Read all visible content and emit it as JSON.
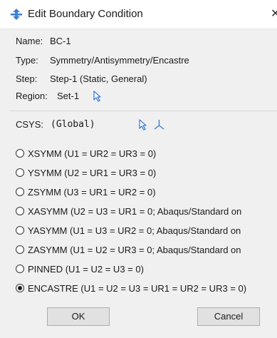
{
  "window": {
    "title": "Edit Boundary Condition",
    "close_glyph": "✕",
    "title_icon": "boundary-condition-icon"
  },
  "info": {
    "name_label": "Name:",
    "name_value": "BC-1",
    "type_label": "Type:",
    "type_value": "Symmetry/Antisymmetry/Encastre",
    "step_label": "Step:",
    "step_value": "Step-1 (Static, General)",
    "region_label": "Region:",
    "region_value": "Set-1"
  },
  "csys": {
    "label": "CSYS:",
    "value": "(Global)"
  },
  "options": [
    {
      "label": "XSYMM (U1 = UR2 = UR3 = 0)",
      "selected": false
    },
    {
      "label": "YSYMM (U2 = UR1 = UR3 = 0)",
      "selected": false
    },
    {
      "label": "ZSYMM (U3 = UR1 = UR2 = 0)",
      "selected": false
    },
    {
      "label": "XASYMM (U2 = U3 = UR1 = 0; Abaqus/Standard on",
      "selected": false
    },
    {
      "label": "YASYMM (U1 = U3 = UR2 = 0; Abaqus/Standard on",
      "selected": false
    },
    {
      "label": "ZASYMM (U1 = U2 = UR3 = 0; Abaqus/Standard on",
      "selected": false
    },
    {
      "label": "PINNED (U1 = U2 = U3 = 0)",
      "selected": false
    },
    {
      "label": "ENCASTRE (U1 = U2 = U3 = UR1 = UR2 = UR3 = 0)",
      "selected": true
    }
  ],
  "buttons": {
    "ok": "OK",
    "cancel": "Cancel"
  },
  "colors": {
    "accent": "#3c7fd6",
    "panel_bg": "#f0f0f0",
    "button_bg": "#e1e1e1"
  }
}
